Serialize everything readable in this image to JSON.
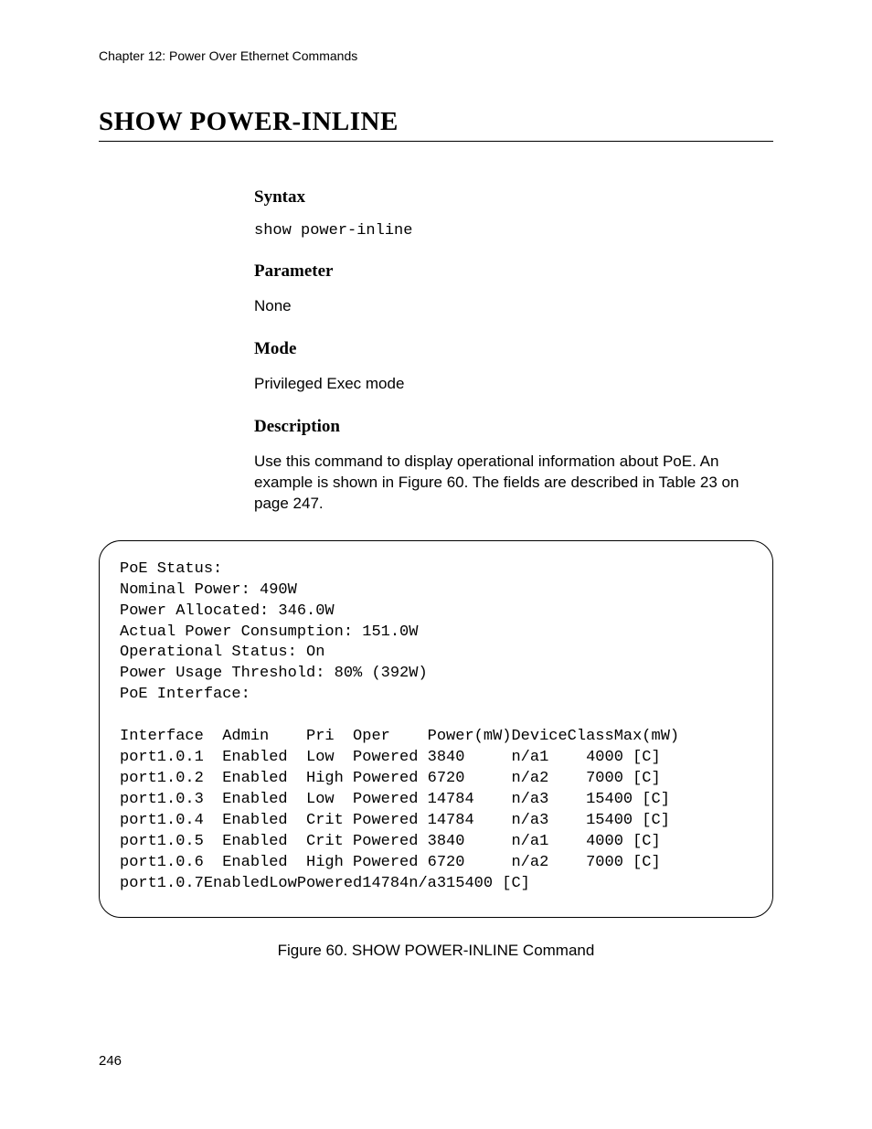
{
  "header": {
    "chapter": "Chapter 12: Power Over Ethernet Commands"
  },
  "title": "SHOW POWER-INLINE",
  "sections": {
    "syntax": {
      "heading": "Syntax",
      "content": "show power-inline"
    },
    "parameter": {
      "heading": "Parameter",
      "content": "None"
    },
    "mode": {
      "heading": "Mode",
      "content": "Privileged Exec mode"
    },
    "description": {
      "heading": "Description",
      "content": "Use this command to display operational information about PoE. An example is shown in Figure 60. The fields are described in Table 23 on page 247."
    }
  },
  "output": {
    "status_lines": [
      "PoE Status:",
      "Nominal Power: 490W",
      "Power Allocated: 346.0W",
      "Actual Power Consumption: 151.0W",
      "Operational Status: On",
      "Power Usage Threshold: 80% (392W)",
      "PoE Interface:"
    ],
    "table_header": "Interface  Admin    Pri  Oper    Power(mW)DeviceClassMax(mW)",
    "table_rows": [
      "port1.0.1  Enabled  Low  Powered 3840     n/a1    4000 [C]",
      "port1.0.2  Enabled  High Powered 6720     n/a2    7000 [C]",
      "port1.0.3  Enabled  Low  Powered 14784    n/a3    15400 [C]",
      "port1.0.4  Enabled  Crit Powered 14784    n/a3    15400 [C]",
      "port1.0.5  Enabled  Crit Powered 3840     n/a1    4000 [C]",
      "port1.0.6  Enabled  High Powered 6720     n/a2    7000 [C]",
      "port1.0.7EnabledLowPowered14784n/a315400 [C]"
    ]
  },
  "figure_caption": "Figure 60. SHOW POWER-INLINE Command",
  "page_number": "246"
}
